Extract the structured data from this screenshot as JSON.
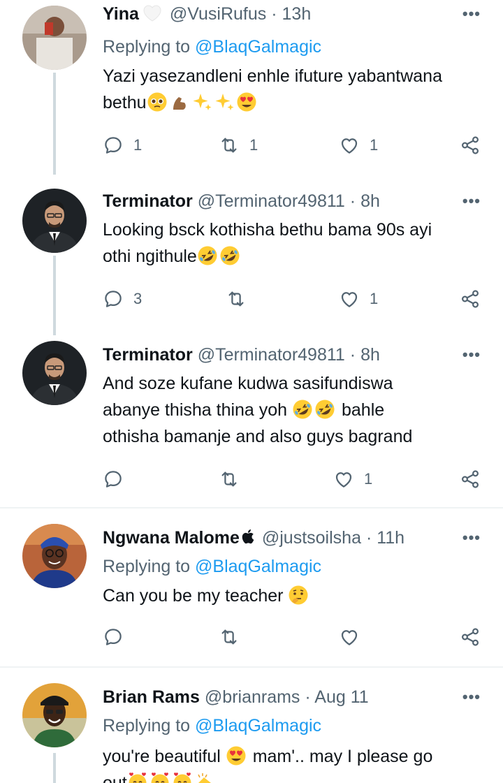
{
  "tweets": [
    {
      "name": "Yina",
      "name_emoji": "white-heart",
      "handle": "@VusiRufus",
      "sep": "·",
      "time": "13h",
      "replying_prefix": "Replying to",
      "replying_to": "@BlaqGalmagic",
      "text_line1": "Yazi yasezandleni enhle ifuture yabantwana",
      "text_line2": "bethu",
      "emojis": [
        "pleading-face",
        "flexed-biceps",
        "sparkles",
        "sparkles",
        "heart-eyes-face"
      ],
      "replies": "1",
      "retweets": "1",
      "likes": "1"
    },
    {
      "name": "Terminator",
      "handle": "@Terminator49811",
      "sep": "·",
      "time": "8h",
      "text_line1": "Looking bsck kothisha bethu bama 90s ayi",
      "text_line2": "othi ngithule",
      "emojis": [
        "rolling-laughing-face",
        "rolling-laughing-face"
      ],
      "replies": "3",
      "retweets": "",
      "likes": "1"
    },
    {
      "name": "Terminator",
      "handle": "@Terminator49811",
      "sep": "·",
      "time": "8h",
      "text_line1": "And soze kufane kudwa sasifundiswa",
      "text_line2a": "abanye thisha thina yoh",
      "text_line2b": "bahle",
      "text_line3": "othisha bamanje and also guys bagrand",
      "emojis": [
        "rolling-laughing-face",
        "rolling-laughing-face"
      ],
      "replies": "",
      "retweets": "",
      "likes": "1"
    },
    {
      "name": "Ngwana Malome",
      "name_emoji": "apple-logo",
      "handle": "@justsoilsha",
      "sep": "·",
      "time": "11h",
      "replying_prefix": "Replying to",
      "replying_to": "@BlaqGalmagic",
      "text_line1": "Can you be my teacher",
      "emojis": [
        "thinking-face"
      ],
      "replies": "",
      "retweets": "",
      "likes": ""
    },
    {
      "name": "Brian Rams",
      "handle": "@brianrams",
      "sep": "·",
      "time": "Aug 11",
      "replying_prefix": "Replying to",
      "replying_to": "@BlaqGalmagic",
      "text_line1a": "you're beautiful",
      "text_line1b": "mam'.. may I please go",
      "text_line2": "out",
      "emojis": [
        "heart-eyes-face",
        "smiling-face-with-hearts",
        "smiling-face-with-hearts",
        "smiling-face-with-hearts",
        "clapping-hands"
      ]
    }
  ],
  "more_label": "•••",
  "colors": {
    "text": "#0f1419",
    "secondary": "#536471",
    "accent": "#1d9bf0",
    "thread_line": "#cfd9de",
    "divider": "#eff3f4"
  }
}
